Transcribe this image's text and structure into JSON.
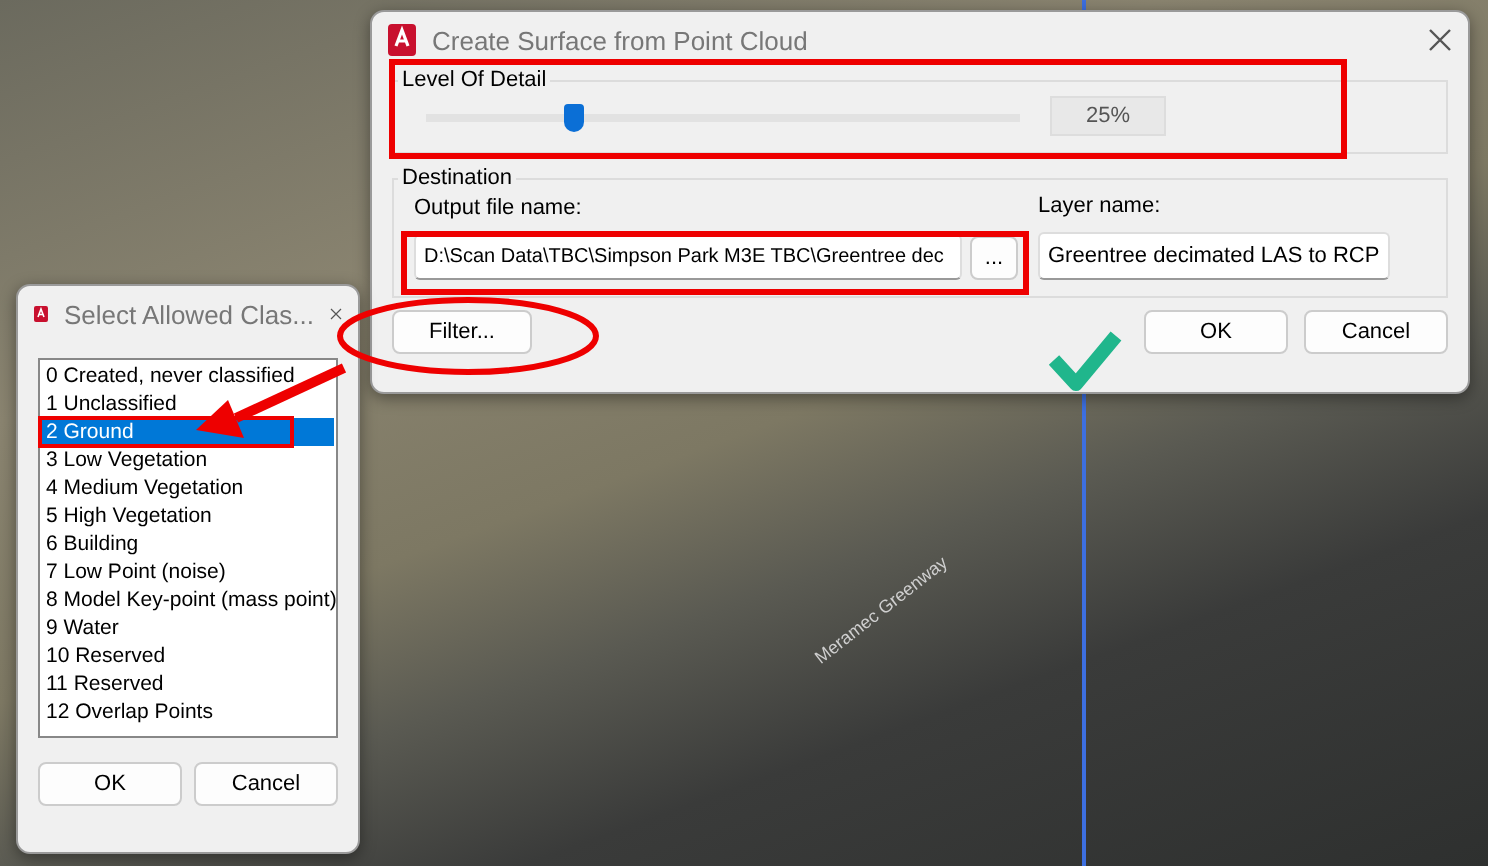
{
  "surface_dialog": {
    "title": "Create Surface from Point Cloud",
    "level_of_detail": {
      "label": "Level Of Detail",
      "level": 0.25,
      "reading": "25%"
    },
    "destination": {
      "label": "Destination",
      "output_file_label": "Output file name:",
      "output_file_value": "D:\\Scan Data\\TBC\\Simpson Park M3E TBC\\Greentree dec",
      "browse_button": "...",
      "layer_label": "Layer name:",
      "layer_value": "Greentree decimated LAS to RCP"
    },
    "filter_button": "Filter...",
    "ok_button": "OK",
    "cancel_button": "Cancel"
  },
  "class_dialog": {
    "title": "Select Allowed Clas...",
    "items": [
      {
        "label": "0 Created, never classified",
        "selected": false
      },
      {
        "label": "1 Unclassified",
        "selected": false
      },
      {
        "label": "2 Ground",
        "selected": true
      },
      {
        "label": "3 Low Vegetation",
        "selected": false
      },
      {
        "label": "4 Medium Vegetation",
        "selected": false
      },
      {
        "label": "5 High Vegetation",
        "selected": false
      },
      {
        "label": "6 Building",
        "selected": false
      },
      {
        "label": "7 Low Point (noise)",
        "selected": false
      },
      {
        "label": "8 Model Key-point (mass point)",
        "selected": false
      },
      {
        "label": "9 Water",
        "selected": false
      },
      {
        "label": "10 Reserved",
        "selected": false
      },
      {
        "label": "11 Reserved",
        "selected": false
      },
      {
        "label": "12 Overlap Points",
        "selected": false
      }
    ],
    "ok_button": "OK",
    "cancel_button": "Cancel"
  },
  "map_label": "Meramec Greenway"
}
